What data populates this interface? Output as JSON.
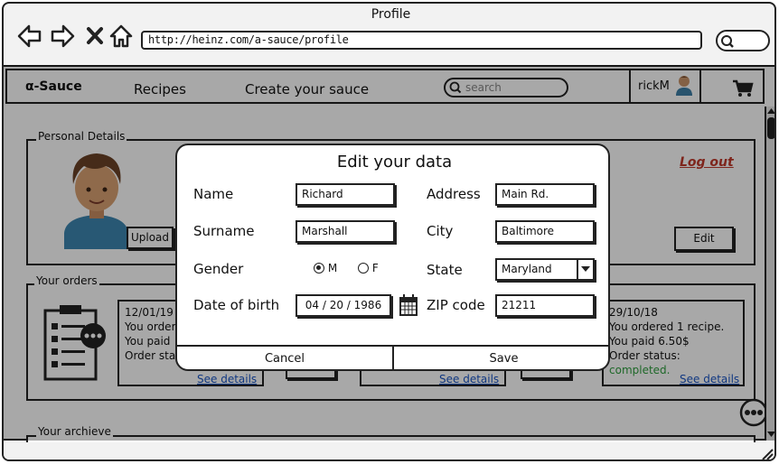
{
  "browser": {
    "title": "Profile",
    "url": "http://heinz.com/a-sauce/profile"
  },
  "nav": {
    "brand": "α-Sauce",
    "links": [
      "Recipes",
      "Create your sauce"
    ],
    "search_placeholder": "search",
    "username": "rickM"
  },
  "personal": {
    "section_label": "Personal Details",
    "upload_label": "Upload",
    "logout_label": "Log out",
    "edit_label": "Edit"
  },
  "orders": {
    "section_label": "Your orders",
    "cards": [
      {
        "date": "12/01/19",
        "line1": "You order",
        "line2": "You paid",
        "line3": "Order statu",
        "link": "See details"
      },
      {
        "date": "",
        "line1": "",
        "line2": "",
        "line3": "",
        "link": "See details"
      },
      {
        "date": "29/10/18",
        "line1": "You ordered 1 recipe.",
        "line2": "You paid 6.50$",
        "line3_prefix": "Order status: ",
        "status": "completed.",
        "link": "See details"
      }
    ]
  },
  "archive": {
    "section_label": "Your archieve"
  },
  "modal": {
    "title": "Edit your data",
    "name_label": "Name",
    "name_value": "Richard",
    "surname_label": "Surname",
    "surname_value": "Marshall",
    "gender_label": "Gender",
    "gender_options": [
      "M",
      "F"
    ],
    "gender_selected": "M",
    "dob_label": "Date of birth",
    "dob_value": "04 / 20 / 1986",
    "address_label": "Address",
    "address_value": "Main Rd.",
    "city_label": "City",
    "city_value": "Baltimore",
    "state_label": "State",
    "state_value": "Maryland",
    "zip_label": "ZIP code",
    "zip_value": "21211",
    "cancel_label": "Cancel",
    "save_label": "Save"
  },
  "colors": {
    "link": "#1a56c6",
    "logout": "#c0392b",
    "status_completed": "#2e9e3e",
    "overlay": "rgba(0,0,0,0.34)"
  },
  "icons": [
    "back-arrow-icon",
    "forward-arrow-icon",
    "close-icon",
    "home-icon",
    "search-icon",
    "cart-icon",
    "avatar-icon",
    "calendar-icon",
    "dropdown-chevron-icon",
    "clipboard-icon",
    "more-icon",
    "resize-grip-icon"
  ]
}
